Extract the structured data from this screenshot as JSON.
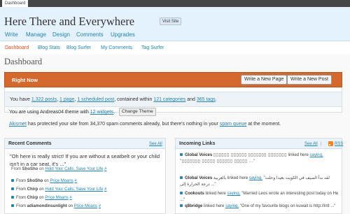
{
  "admin_bar": {
    "dashboard_tab": "Dashboard"
  },
  "header": {
    "site_title": "Here There and Everywhere",
    "visit_site": "Visit Site"
  },
  "main_nav": [
    "Write",
    "Manage",
    "Design",
    "Comments",
    "Upgrades"
  ],
  "sub_nav": [
    "Dashboard",
    "Blog Stats",
    "Blog Surfer",
    "My Comments",
    "Tag Surfer"
  ],
  "page_title": "Dashboard",
  "right_now": {
    "title": "Right Now",
    "write_page": "Write a New Page",
    "write_post": "Write a New Post",
    "stats": {
      "you_have": "You have",
      "posts": "1,322 posts",
      "sep1": ",",
      "pages": "1 page",
      "sep2": ",",
      "scheduled": "1 scheduled post",
      "contained": ", contained within",
      "categories": "121 categories",
      "and": "and",
      "tags": "365 tags",
      "end": "."
    },
    "theme": {
      "prefix": "You are using Andreas04 theme with",
      "widgets": "12 widgets",
      "end": ".",
      "change_theme": "Change Theme"
    },
    "akismet": {
      "name": "Akismet",
      "text": "has protected your site from 34,370 spam comments already, but there's nothing in your",
      "spam_queue": "spam queue",
      "end": "at the moment."
    }
  },
  "recent_comments": {
    "title": "Recent Comments",
    "see_all": "See All",
    "quote": "\"Oh here is really strict! If you are without a seatbelt or your child isn't in a car seat, it's ...\"",
    "quote_by": {
      "from": "From",
      "author": "ShoSho",
      "on": "on",
      "post": "Hold Your Calls, Save Your Life",
      "hash": "#"
    },
    "items": [
      {
        "from": "From",
        "author": "ShoSho",
        "on": "on",
        "post": "Price Moans",
        "hash": "#"
      },
      {
        "from": "From",
        "author": "Chirp",
        "on": "on",
        "post": "Hold Your Calls, Save Your Life",
        "hash": "#"
      },
      {
        "from": "From",
        "author": "Chirp",
        "on": "on",
        "post": "Price Moans",
        "hash": "#"
      },
      {
        "from": "From",
        "author": "adiamondinsunlight",
        "on": "on",
        "post": "Price Moans",
        "hash": "#"
      }
    ]
  },
  "incoming_links": {
    "title": "Incoming Links",
    "see_all": "See All",
    "rss": "RSS",
    "items": [
      {
        "source": "Global Voices",
        "boxes1": "▯▯▯▯▯▯ ▯▯▯▯▯▯",
        "boxes2": "▯▯▯▯▯▯▯ ▯▯▯▯▯▯▯",
        "linked": "linked here",
        "saying": "saying,",
        "quote": "\"▯▯▯▯▯▯▯ ▯▯▯▯▯ ▯▯▯▯▯▯ ▯▯▯▯▯ ...\""
      },
      {
        "source": "Global Voices",
        "boxes1": "بالعربية",
        "boxes2": "",
        "linked": "linked here",
        "saying": "saying,",
        "quote": "\"لقد بدأ الصيف في الكويت بعيدا وحلت درجة الحرارة إلى ...\""
      },
      {
        "source": "Cookouts",
        "boxes1": "",
        "boxes2": "",
        "linked": "linked here",
        "saying": "saying,",
        "quote": "\"Married Leos wrote an interesting post today on He ...\""
      },
      {
        "source": "q8bridge",
        "boxes1": "",
        "boxes2": "",
        "linked": "linked here",
        "saying": "saying,",
        "quote": "\"One of my favourite blogs on kuwait is http://intl ...\""
      }
    ]
  },
  "colors": {
    "accent_orange": "#d3692c",
    "link_blue": "#2583ad",
    "header_bg": "#e4f2fd",
    "current_nav": "#d54e21"
  }
}
